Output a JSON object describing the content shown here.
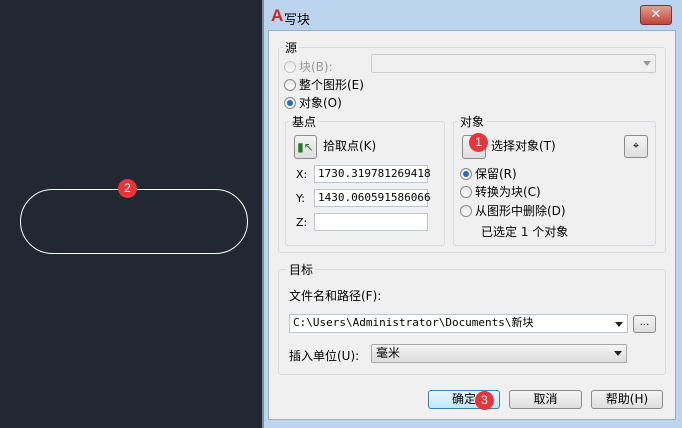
{
  "canvas": {
    "badge": "2"
  },
  "dialog": {
    "title": "写块",
    "source": {
      "label": "源",
      "block_radio": "块(B):",
      "entire_radio": "整个图形(E)",
      "objects_radio": "对象(O)",
      "selected": "objects"
    },
    "base_point": {
      "label": "基点",
      "pick_label": "拾取点(K)",
      "x_label": "X:",
      "x_value": "1730.319781269418",
      "y_label": "Y:",
      "y_value": "1430.060591586066",
      "z_label": "Z:",
      "z_value": ""
    },
    "objects": {
      "label": "对象",
      "select_label": "选择对象(T)",
      "badge": "1",
      "retain": "保留(R)",
      "convert": "转换为块(C)",
      "delete": "从图形中删除(D)",
      "selected_mode": "retain",
      "status": "已选定 1 个对象"
    },
    "destination": {
      "label": "目标",
      "file_label": "文件名和路径(F):",
      "file_value": "C:\\Users\\Administrator\\Documents\\新块",
      "browse": "...",
      "units_label": "插入单位(U):",
      "units_value": "毫米"
    },
    "buttons": {
      "ok": "确定",
      "ok_badge": "3",
      "cancel": "取消",
      "help": "帮助(H)"
    }
  }
}
